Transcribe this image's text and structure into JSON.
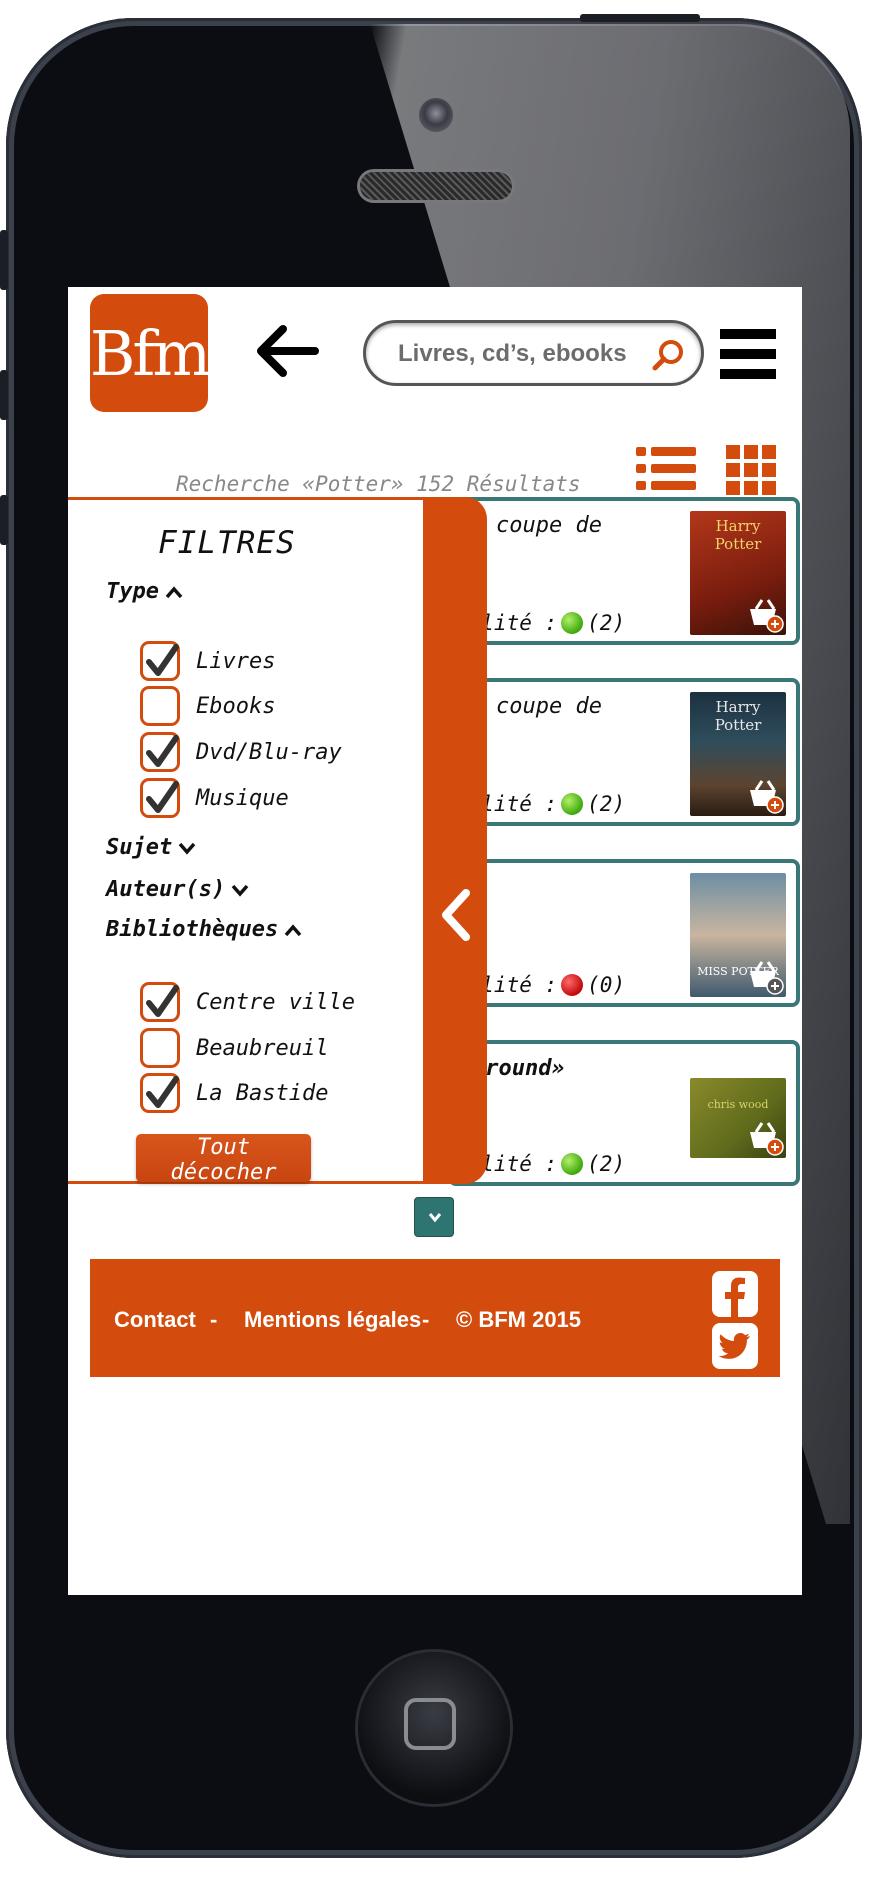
{
  "app": {
    "logo_text": "Bfm"
  },
  "header": {
    "search_placeholder": "Livres, cd’s, ebooks"
  },
  "results": {
    "summary": "Recherche «Potter» 152 Résultats"
  },
  "cards": [
    {
      "title": "coupe de",
      "avail_label": "bilité :",
      "status": "green",
      "count": "(2)",
      "cover_text": "Harry Potter"
    },
    {
      "title": "coupe de",
      "avail_label": "bilité :",
      "status": "green",
      "count": "(2)",
      "cover_text": "Harry Potter"
    },
    {
      "title": "",
      "avail_label": "bilité :",
      "status": "red",
      "count": "(0)",
      "cover_text": "MISS POTTER"
    },
    {
      "title": "ground»",
      "avail_label": "bilité :",
      "status": "green",
      "count": "(2)",
      "cover_text": "chris wood"
    }
  ],
  "filters": {
    "title": "FILTRES",
    "type": {
      "label": "Type",
      "expanded": true,
      "items": [
        {
          "label": "Livres",
          "checked": true
        },
        {
          "label": "Ebooks",
          "checked": false
        },
        {
          "label": "Dvd/Blu-ray",
          "checked": true
        },
        {
          "label": "Musique",
          "checked": true
        }
      ]
    },
    "sujet": {
      "label": "Sujet",
      "expanded": false
    },
    "auteurs": {
      "label": "Auteur(s)",
      "expanded": false
    },
    "bibliotheques": {
      "label": "Bibliothèques",
      "expanded": true,
      "items": [
        {
          "label": "Centre ville",
          "checked": true
        },
        {
          "label": "Beaubreuil",
          "checked": false
        },
        {
          "label": "La Bastide",
          "checked": true
        }
      ]
    },
    "uncheck_all_label": "Tout décocher"
  },
  "footer": {
    "contact": "Contact",
    "sep1": "-",
    "legal": "Mentions légales",
    "sep2": "-",
    "copyright": "© BFM 2015"
  },
  "colors": {
    "accent": "#d44b0e",
    "card_border": "#3a7777",
    "status_green": "#3da80d",
    "status_red": "#c10a0a"
  },
  "icons": [
    "back-arrow-icon",
    "search-icon",
    "hamburger-menu-icon",
    "list-view-icon",
    "grid-view-icon",
    "basket-add-icon",
    "chevron-left-icon",
    "chevron-down-icon",
    "chevron-up-icon",
    "checkmark-icon",
    "facebook-icon",
    "twitter-icon"
  ]
}
